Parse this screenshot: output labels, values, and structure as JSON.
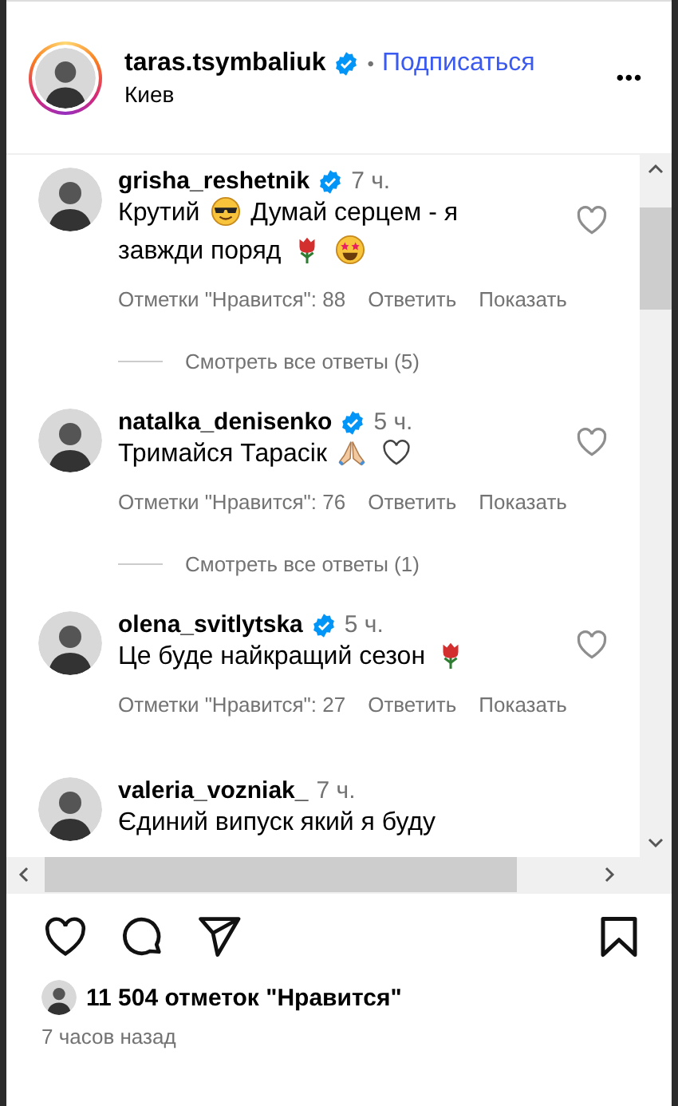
{
  "header": {
    "username": "taras.tsymbaliuk",
    "verified": true,
    "separator": "•",
    "follow": "Подписаться",
    "location": "Киев",
    "more": "•••"
  },
  "comments": [
    {
      "username": "grisha_reshetnik",
      "verified": true,
      "time": "7 ч.",
      "parts": [
        {
          "kind": "text",
          "text": "Крутий"
        },
        {
          "kind": "sunglasses"
        },
        {
          "kind": "text",
          "text": "Думай серцем - я завжди поряд"
        },
        {
          "kind": "rose"
        },
        {
          "kind": "starstruck"
        }
      ],
      "likes": "Отметки \"Нравится\": 88",
      "reply": "Ответить",
      "show": "Показать",
      "replies": "Смотреть все ответы (5)"
    },
    {
      "username": "natalka_denisenko",
      "verified": true,
      "time": "5 ч.",
      "parts": [
        {
          "kind": "text",
          "text": "Тримайся Тарасік"
        },
        {
          "kind": "pray"
        },
        {
          "kind": "whiteheart"
        }
      ],
      "likes": "Отметки \"Нравится\": 76",
      "reply": "Ответить",
      "show": "Показать",
      "replies": "Смотреть все ответы (1)"
    },
    {
      "username": "olena_svitlytska",
      "verified": true,
      "time": "5 ч.",
      "parts": [
        {
          "kind": "text",
          "text": "Це буде найкращий сезон"
        },
        {
          "kind": "rose"
        }
      ],
      "likes": "Отметки \"Нравится\": 27",
      "reply": "Ответить",
      "show": "Показать"
    },
    {
      "username": "valeria_vozniak_",
      "verified": false,
      "time": "7 ч.",
      "parts": [
        {
          "kind": "text",
          "text": "Єдиний випуск який я буду"
        }
      ]
    }
  ],
  "likes": "11 504 отметок \"Нравится\"",
  "posted": "7 часов назад"
}
